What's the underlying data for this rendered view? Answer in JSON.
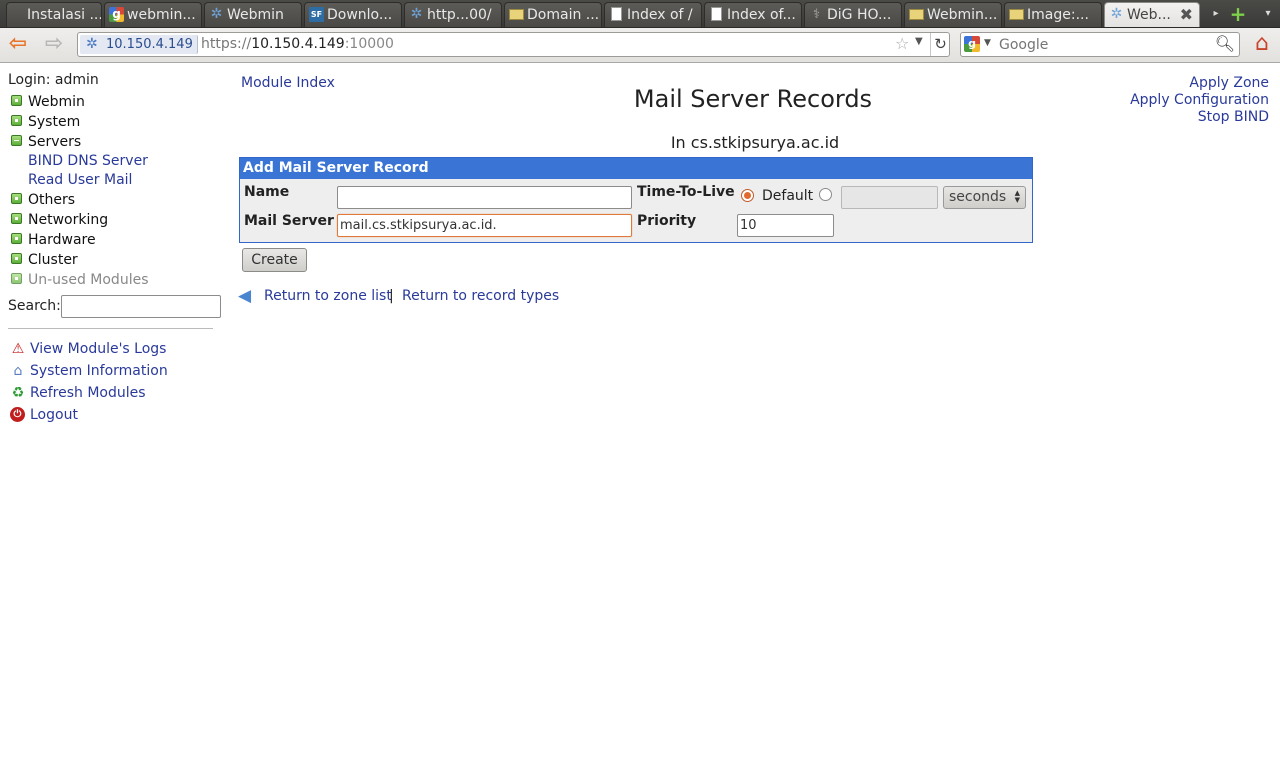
{
  "browser": {
    "tabs": [
      {
        "label": "Instalasi ...",
        "icon": "page-icon"
      },
      {
        "label": "webmin...",
        "icon": "google-icon"
      },
      {
        "label": "Webmin",
        "icon": "webmin-icon"
      },
      {
        "label": "Downlo...",
        "icon": "sourceforge-icon"
      },
      {
        "label": "http...00/",
        "icon": "webmin-icon"
      },
      {
        "label": "Domain ...",
        "icon": "folder-icon"
      },
      {
        "label": "Index of /",
        "icon": "page-icon"
      },
      {
        "label": "Index of...",
        "icon": "page-icon"
      },
      {
        "label": "DiG HO...",
        "icon": "dig-icon"
      },
      {
        "label": "Webmin...",
        "icon": "folder-icon"
      },
      {
        "label": "Image:...",
        "icon": "folder-icon"
      },
      {
        "label": "Web...",
        "icon": "webmin-icon",
        "active": true
      }
    ],
    "site_identity": "10.150.4.149",
    "url": {
      "scheme": "https://",
      "host": "10.150.4.149",
      "port": ":10000"
    },
    "search_placeholder": "Google",
    "sf_glyph": "SF",
    "g_glyph": "g"
  },
  "sidebar": {
    "login": "Login: admin",
    "categories": [
      {
        "label": "Webmin",
        "open": false
      },
      {
        "label": "System",
        "open": false
      },
      {
        "label": "Servers",
        "open": true
      },
      {
        "label": "Others",
        "open": false
      },
      {
        "label": "Networking",
        "open": false
      },
      {
        "label": "Hardware",
        "open": false
      },
      {
        "label": "Cluster",
        "open": false
      },
      {
        "label": "Un-used Modules",
        "open": false,
        "unused": true
      }
    ],
    "server_modules": [
      "BIND DNS Server",
      "Read User Mail"
    ],
    "search_label": "Search:",
    "actions": [
      {
        "label": "View Module's Logs",
        "icon": "warning-icon"
      },
      {
        "label": "System Information",
        "icon": "system-info-icon"
      },
      {
        "label": "Refresh Modules",
        "icon": "refresh-icon"
      },
      {
        "label": "Logout",
        "icon": "logout-icon"
      }
    ]
  },
  "main": {
    "module_index": "Module Index",
    "title": "Mail Server Records",
    "subtitle": "In cs.stkipsurya.ac.id",
    "right_links": [
      "Apply Zone",
      "Apply Configuration",
      "Stop BIND"
    ],
    "form": {
      "header": "Add Mail Server Record",
      "name_label": "Name",
      "name_value": "",
      "ttl_label": "Time-To-Live",
      "ttl_default_label": "Default",
      "ttl_default_selected": true,
      "ttl_value": "",
      "ttl_unit": "seconds",
      "mail_server_label": "Mail Server",
      "mail_server_value": "mail.cs.stkipsurya.ac.id.",
      "priority_label": "Priority",
      "priority_value": "10"
    },
    "create_button": "Create",
    "return_links": [
      "Return to zone list",
      "Return to record types"
    ],
    "return_separator": "|"
  },
  "colors": {
    "link": "#2a3a9a",
    "form_header_bg": "#3a75d6",
    "form_border": "#3366cc",
    "focus_border": "#e07a3c"
  }
}
